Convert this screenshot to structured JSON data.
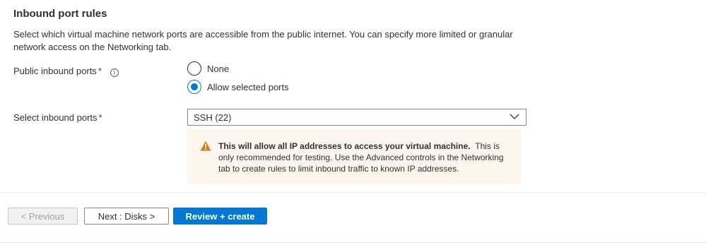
{
  "section": {
    "title": "Inbound port rules",
    "description": "Select which virtual machine network ports are accessible from the public internet. You can specify more limited or granular network access on the Networking tab."
  },
  "public_inbound_ports": {
    "label": "Public inbound ports",
    "required_mark": "*",
    "info_icon": "info-icon",
    "options": [
      {
        "label": "None",
        "selected": false
      },
      {
        "label": "Allow selected ports",
        "selected": true
      }
    ]
  },
  "select_inbound_ports": {
    "label": "Select inbound ports",
    "required_mark": "*",
    "value": "SSH (22)"
  },
  "warning": {
    "icon": "warning-icon",
    "bold_text": "This will allow all IP addresses to access your virtual machine.",
    "text": "This is only recommended for testing.  Use the Advanced controls in the Networking tab to create rules to limit inbound traffic to known IP addresses."
  },
  "footer": {
    "previous_label": "< Previous",
    "next_label": "Next : Disks >",
    "review_label": "Review + create"
  },
  "colors": {
    "accent": "#0078d4",
    "required": "#a4262c",
    "warning_bg": "#fdf6ef",
    "warning_icon": "#d47e1f"
  }
}
